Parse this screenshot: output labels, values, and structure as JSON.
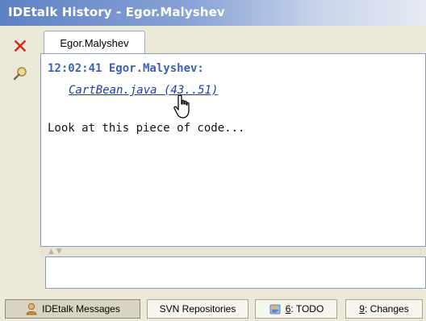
{
  "window": {
    "title": "IDEtalk History - Egor.Malyshev"
  },
  "sidebar": {
    "close_icon": "close-icon",
    "search_icon": "magnifier-icon"
  },
  "tabs": [
    {
      "label": "Egor.Malyshev"
    }
  ],
  "messages": [
    {
      "header": "12:02:41 Egor.Malyshev:",
      "link": "CartBean.java (43..51)",
      "body": "Look at this piece of code..."
    }
  ],
  "splitter": {
    "arrows": "▲ ▼"
  },
  "bottom_tabs": [
    {
      "label": "IDEtalk Messages",
      "icon": "user-icon",
      "active": true
    },
    {
      "label": "SVN Repositories"
    },
    {
      "mnemonic": "6",
      "rest": ": TODO",
      "icon": "todo-icon"
    },
    {
      "mnemonic": "9",
      "rest": ": Changes"
    }
  ],
  "colors": {
    "title_gradient_start": "#5f80c4",
    "close_red": "#d9261c",
    "header_blue": "#3d62b5",
    "link_blue": "#1f3da8",
    "chrome": "#ece9d8"
  }
}
